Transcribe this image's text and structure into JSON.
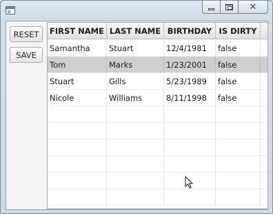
{
  "window": {
    "app_icon": "window-icon",
    "controls": {
      "minimize": "minimize-icon",
      "maximize": "maximize-icon",
      "close_glyph": "✕"
    }
  },
  "side": {
    "reset_label": "RESET",
    "save_label": "SAVE"
  },
  "table": {
    "columns": [
      "FIRST NAME",
      "LAST NAME",
      "BIRTHDAY",
      "IS DIRTY"
    ],
    "rows": [
      {
        "first": "Samantha",
        "last": "Stuart",
        "birthday": "12/4/1981",
        "dirty": "false",
        "selected": false
      },
      {
        "first": "Tom",
        "last": "Marks",
        "birthday": "1/23/2001",
        "dirty": "false",
        "selected": true
      },
      {
        "first": "Stuart",
        "last": "Gills",
        "birthday": "5/23/1989",
        "dirty": "false",
        "selected": false
      },
      {
        "first": "Nicole",
        "last": "Williams",
        "birthday": "8/11/1998",
        "dirty": "false",
        "selected": false
      }
    ],
    "empty_rows": 6
  },
  "colors": {
    "selected_row": "#cfcfcf",
    "header_bg": "#e9e9e9",
    "window_frame": "#d3dde8"
  },
  "cursor": "text-cursor-icon"
}
